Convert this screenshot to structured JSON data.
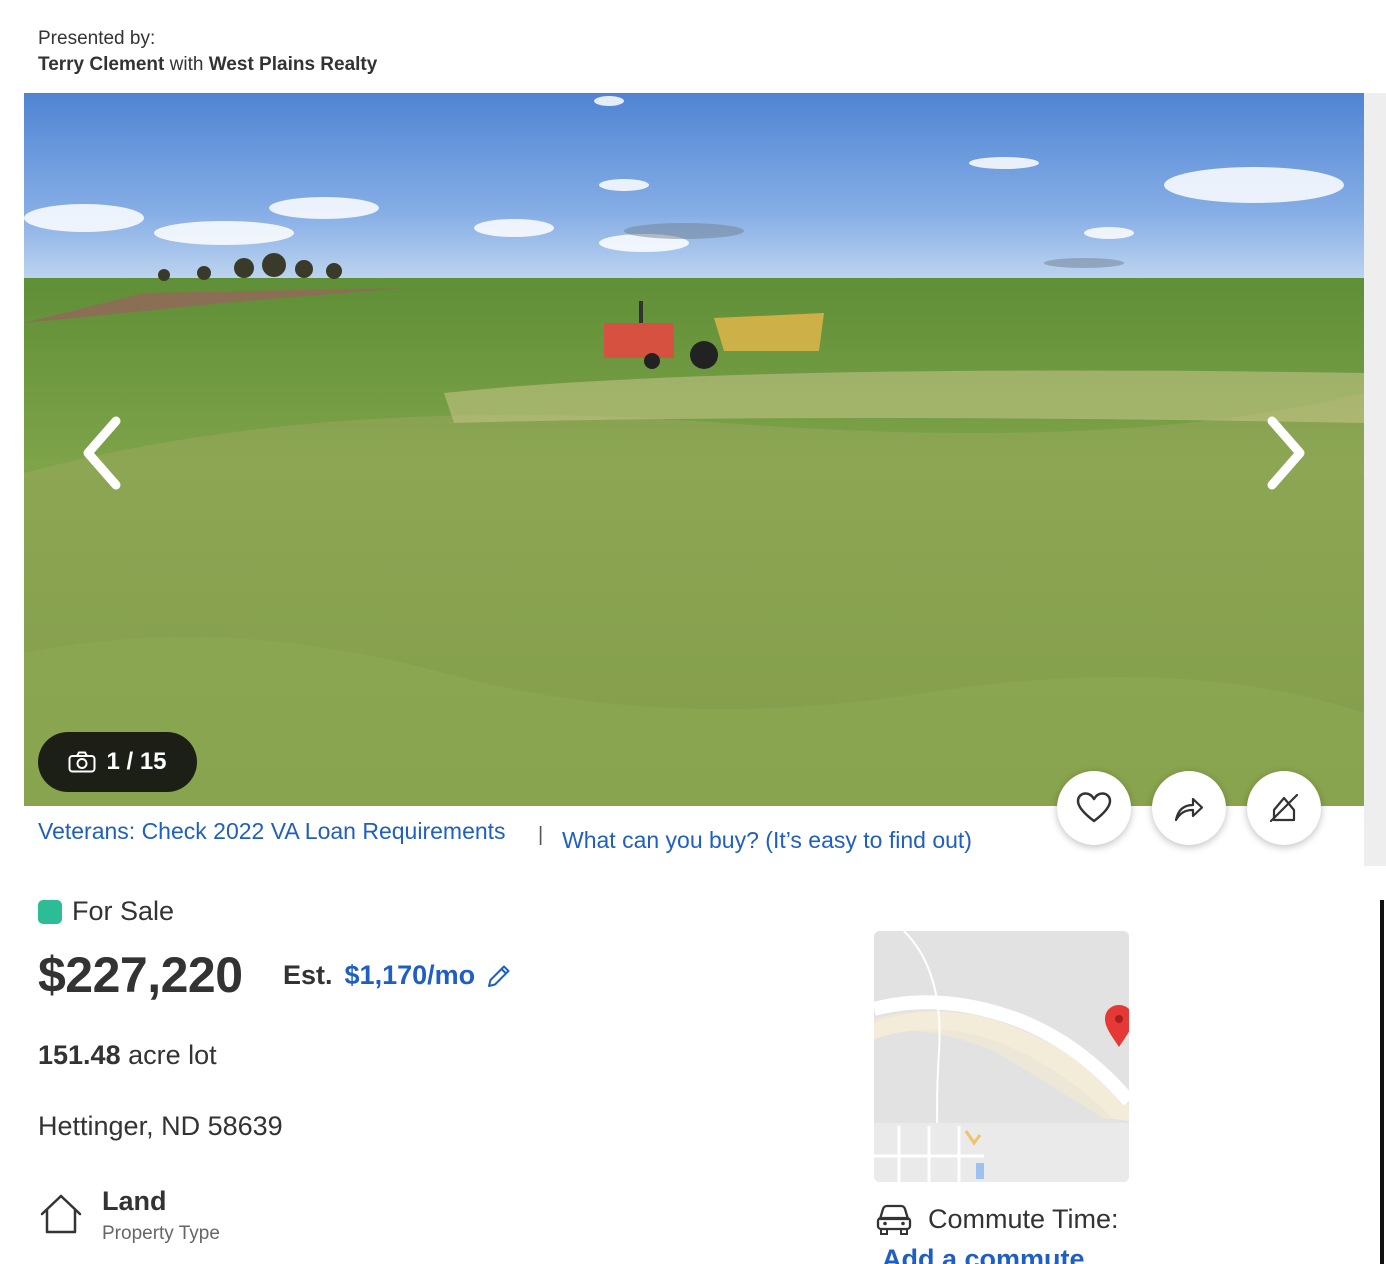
{
  "presented": {
    "label": "Presented by:",
    "agent": "Terry Clement",
    "with": "with",
    "brokerage": "West Plains Realty"
  },
  "gallery": {
    "photo_counter": "1 / 15",
    "icons": {
      "prev": "chevron-left-icon",
      "next": "chevron-right-icon",
      "camera": "camera-icon"
    }
  },
  "actions": [
    {
      "name": "favorite",
      "icon": "heart-icon"
    },
    {
      "name": "share",
      "icon": "share-icon"
    },
    {
      "name": "hide",
      "icon": "hide-icon"
    }
  ],
  "links": {
    "va_loan": "Veterans: Check 2022 VA Loan Requirements",
    "separator": "|",
    "buying_power": "What can you buy? (It’s easy to find out)"
  },
  "listing": {
    "status": "For Sale",
    "status_color": "#2dbd96",
    "price": "$227,220",
    "est_label": "Est.",
    "est_payment": "$1,170/mo",
    "lot_size": "151.48",
    "lot_unit": "acre lot",
    "address": "Hettinger, ND 58639",
    "property_type": "Land",
    "property_type_label": "Property Type"
  },
  "commute": {
    "label": "Commute Time:",
    "link": "Add a commute"
  },
  "colors": {
    "link": "#1f5fc4",
    "text": "#333333"
  }
}
